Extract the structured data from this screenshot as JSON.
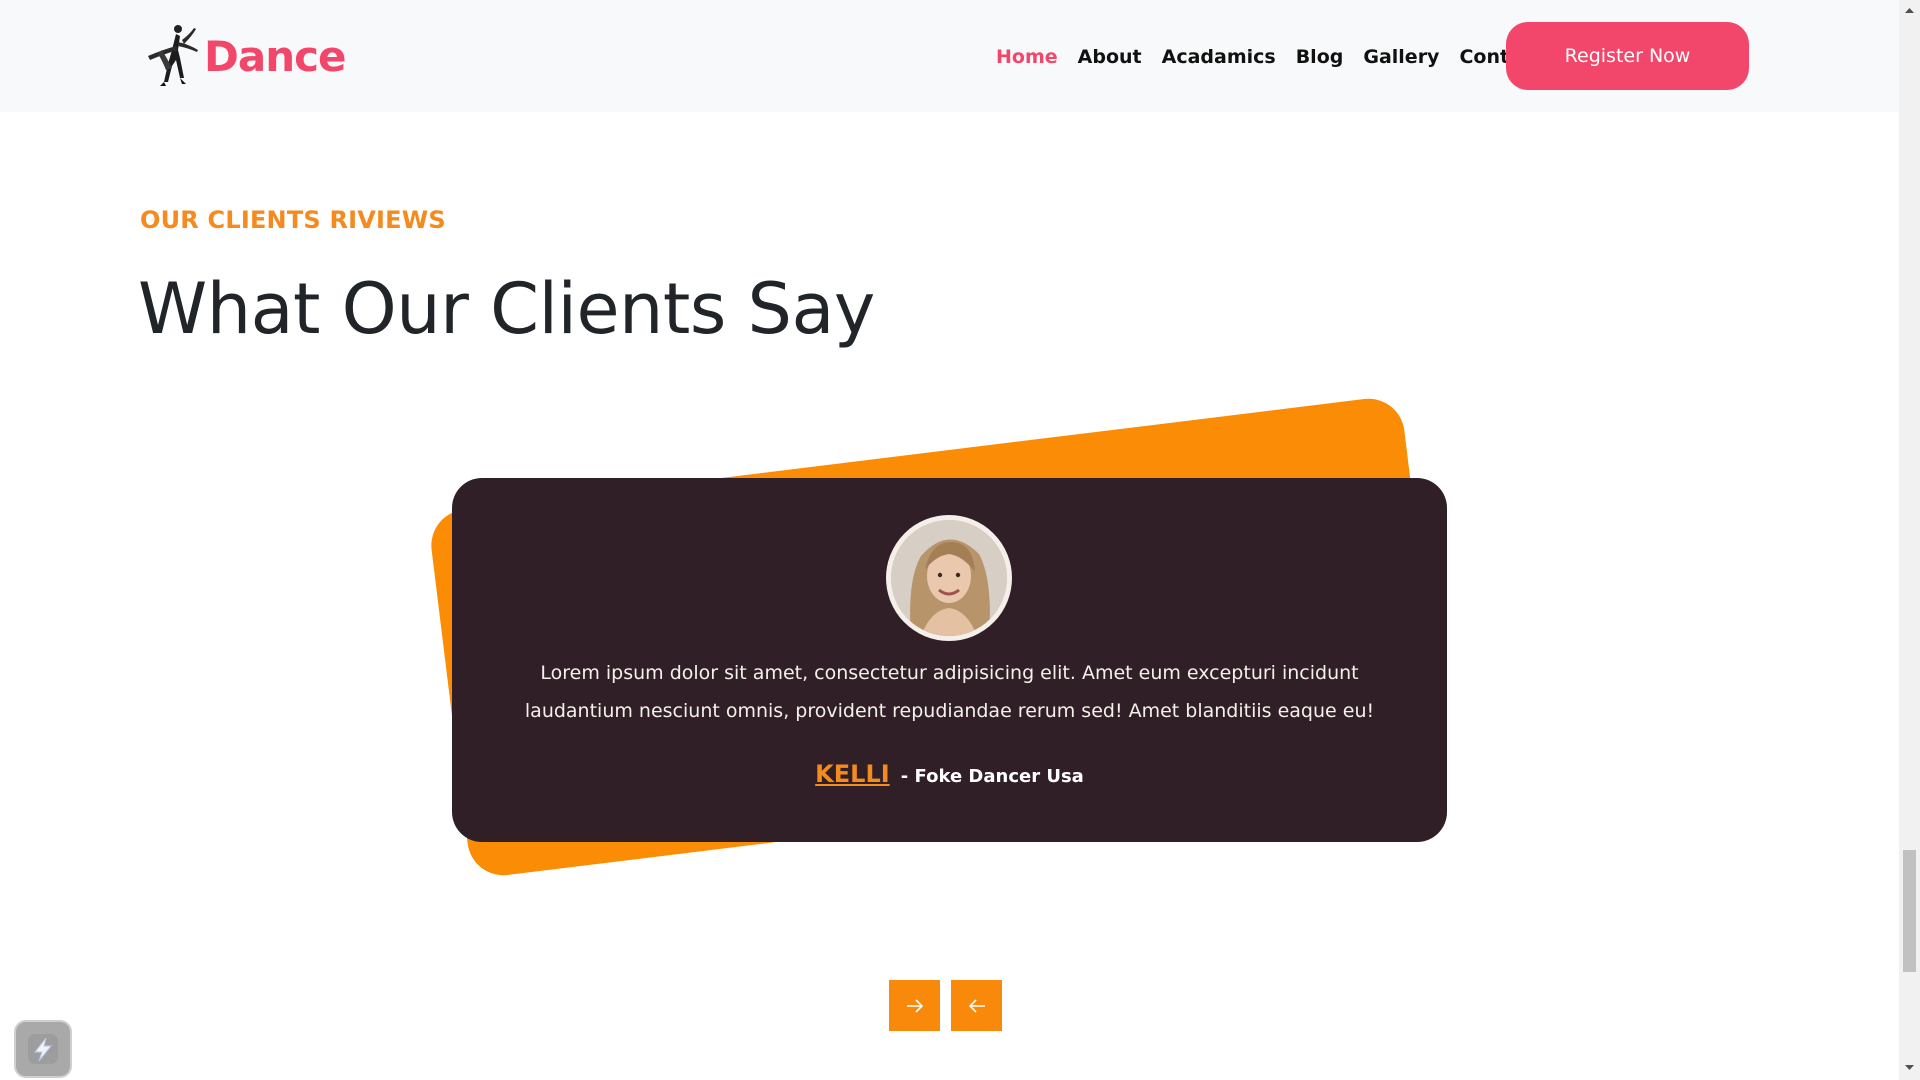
{
  "brand": {
    "name": "Dance",
    "color": "#f2466a"
  },
  "nav": {
    "items": [
      {
        "label": "Home",
        "active": true
      },
      {
        "label": "About",
        "active": false
      },
      {
        "label": "Acadamics",
        "active": false
      },
      {
        "label": "Blog",
        "active": false
      },
      {
        "label": "Gallery",
        "active": false
      },
      {
        "label": "Contact",
        "active": false
      }
    ],
    "register_label": "Register Now"
  },
  "section": {
    "eyebrow": "OUR CLIENTS RIVIEWS",
    "title": "What Our Clients Say"
  },
  "testimonial": {
    "avatar_icon": "client-photo",
    "quote": "Lorem ipsum dolor sit amet, consectetur adipisicing elit. Amet eum excepturi incidunt laudantium nesciunt omnis, provident repudiandae rerum sed! Amet blanditiis eaque eu!",
    "name": "KELLI",
    "role": "- Foke Dancer Usa"
  },
  "slider_controls": {
    "next_icon": "arrow-right-icon",
    "prev_icon": "arrow-left-icon"
  },
  "colors": {
    "accent": "#f58a1f",
    "card_bg": "#301f26",
    "orange_panel": "#fb8c05",
    "button_pink": "#f2466a"
  }
}
